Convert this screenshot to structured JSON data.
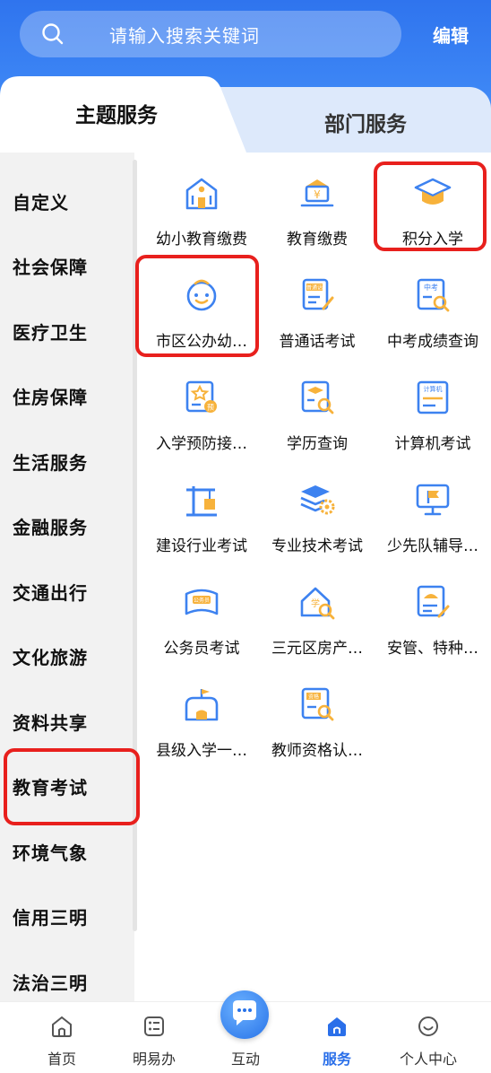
{
  "search": {
    "placeholder": "请输入搜索关键词",
    "edit_label": "编辑"
  },
  "tabs": [
    {
      "label": "主题服务",
      "active": true
    },
    {
      "label": "部门服务",
      "active": false
    }
  ],
  "sidebar": {
    "items": [
      "自定义",
      "社会保障",
      "医疗卫生",
      "住房保障",
      "生活服务",
      "金融服务",
      "交通出行",
      "文化旅游",
      "资料共享",
      "教育考试",
      "环境气象",
      "信用三明",
      "法治三明"
    ],
    "selected": "教育考试"
  },
  "services": [
    {
      "label": "幼小教育缴费",
      "icon": "school-building-icon"
    },
    {
      "label": "教育缴费",
      "icon": "payment-desk-icon"
    },
    {
      "label": "积分入学",
      "icon": "graduation-cap-icon"
    },
    {
      "label": "市区公办幼…",
      "icon": "child-face-icon"
    },
    {
      "label": "普通话考试",
      "icon": "mandarin-exam-icon"
    },
    {
      "label": "中考成绩查询",
      "icon": "exam-score-search-icon"
    },
    {
      "label": "入学预防接…",
      "icon": "vaccination-certificate-icon"
    },
    {
      "label": "学历查询",
      "icon": "education-search-icon"
    },
    {
      "label": "计算机考试",
      "icon": "computer-exam-icon"
    },
    {
      "label": "建设行业考试",
      "icon": "construction-crane-icon"
    },
    {
      "label": "专业技术考试",
      "icon": "technical-gear-icon"
    },
    {
      "label": "少先队辅导…",
      "icon": "flag-screen-icon"
    },
    {
      "label": "公务员考试",
      "icon": "civil-servant-exam-icon"
    },
    {
      "label": "三元区房产…",
      "icon": "house-search-icon"
    },
    {
      "label": "安管、特种…",
      "icon": "safety-helmet-icon"
    },
    {
      "label": "县级入学一…",
      "icon": "school-flag-icon"
    },
    {
      "label": "教师资格认…",
      "icon": "teacher-certificate-icon"
    }
  ],
  "icon_labels": {
    "mandarin": "普通话",
    "zhongkao": "中考",
    "computer": "计算机",
    "civil": "公务员",
    "xue": "学",
    "teacher": "资格",
    "yu": "¥",
    "pin": "预"
  },
  "tabbar": [
    {
      "label": "首页",
      "icon": "home-icon"
    },
    {
      "label": "明易办",
      "icon": "form-list-icon"
    },
    {
      "label": "互动",
      "icon": "chat-bubble-icon"
    },
    {
      "label": "服务",
      "icon": "service-home-icon",
      "active": true
    },
    {
      "label": "个人中心",
      "icon": "smile-user-icon"
    }
  ],
  "colors": {
    "primary": "#2f74ee",
    "accent_orange": "#f7b23b",
    "icon_blue": "#3d82f0",
    "highlight": "#e8201d"
  }
}
